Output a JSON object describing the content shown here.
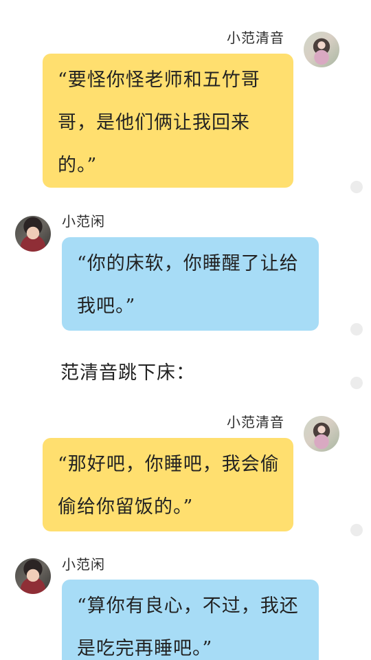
{
  "messages": [
    {
      "speaker": "小范清音",
      "text": "“要怪你怪老师和五竹哥哥，是他们俩让我回来的。”",
      "side": "right",
      "color": "yellow"
    },
    {
      "speaker": "小范闲",
      "text": "“你的床软，你睡醒了让给我吧。”",
      "side": "left",
      "color": "blue"
    },
    {
      "narration": "范清音跳下床："
    },
    {
      "speaker": "小范清音",
      "text": "“那好吧，你睡吧，我会偷偷给你留饭的。”",
      "side": "right",
      "color": "yellow"
    },
    {
      "speaker": "小范闲",
      "text": "“算你有良心，不过，我还是吃完再睡吧。”",
      "side": "left",
      "color": "blue"
    }
  ]
}
